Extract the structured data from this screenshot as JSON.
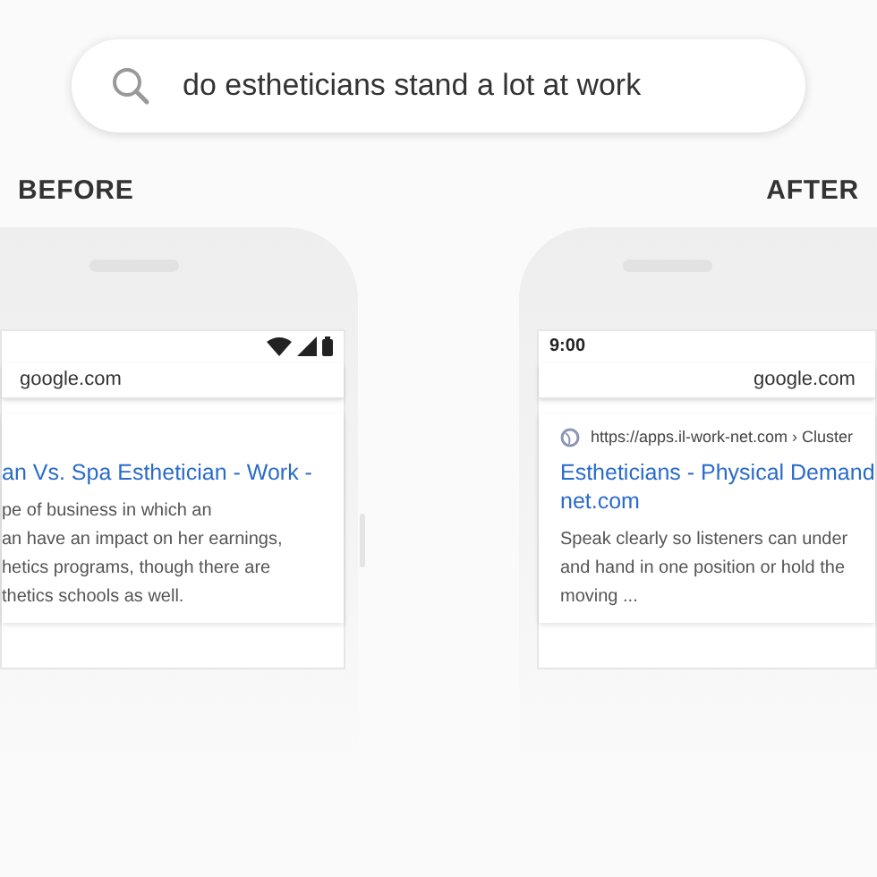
{
  "search": {
    "query": "do estheticians stand a lot at work"
  },
  "panels": [
    {
      "kind": "before",
      "label": "BEFORE",
      "address": "google.com",
      "result": {
        "title_lines": [
          "an Vs. Spa Esthetician - Work -"
        ],
        "snippet_lines": [
          "pe of business in which an",
          "an have an impact on her earnings,",
          "hetics programs, though there are",
          "thetics schools as well."
        ]
      }
    },
    {
      "kind": "after",
      "label": "AFTER",
      "time": "9:00",
      "address": "google.com",
      "result": {
        "url": "https://apps.il-work-net.com › Cluster",
        "title_lines": [
          "Estheticians - Physical Demand",
          "net.com"
        ],
        "snippet_lines": [
          "Speak clearly so listeners can under",
          "and hand in one position or hold the",
          "moving ..."
        ]
      }
    }
  ]
}
